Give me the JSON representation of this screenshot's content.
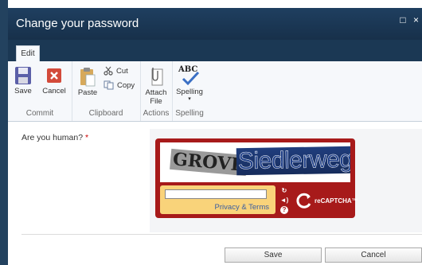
{
  "window": {
    "title": "Change your password",
    "maximize_glyph": "□",
    "close_glyph": "×"
  },
  "ribbon": {
    "tab": "Edit",
    "groups": {
      "commit": {
        "label": "Commit",
        "save": "Save",
        "cancel": "Cancel"
      },
      "clipboard": {
        "label": "Clipboard",
        "paste": "Paste",
        "cut": "Cut",
        "copy": "Copy"
      },
      "actions": {
        "label": "Actions",
        "attach_line1": "Attach",
        "attach_line2": "File"
      },
      "spelling": {
        "label": "Spelling",
        "spelling": "Spelling",
        "icon_text": "ABC"
      }
    }
  },
  "form": {
    "field_label": "Are you human?",
    "required_marker": "*",
    "captcha": {
      "word1": "GROVE",
      "word2": "Siedlerweg",
      "answer_value": "",
      "privacy_link": "Privacy & Terms",
      "logo_text": "reCAPTCHA™",
      "controls": [
        "refresh-icon",
        "audio-icon",
        "help-icon"
      ],
      "colors": {
        "frame": "#a71a1a",
        "answer_area": "#f9d37a"
      }
    }
  },
  "buttons": {
    "save": "Save",
    "cancel": "Cancel"
  }
}
